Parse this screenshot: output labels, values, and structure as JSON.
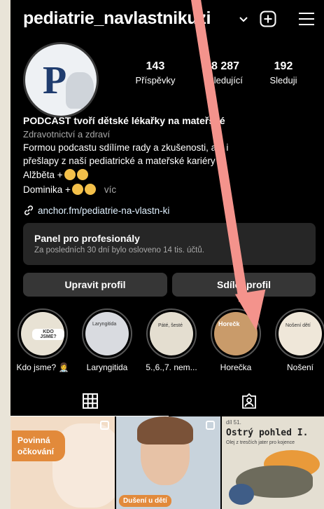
{
  "header": {
    "username": "pediatrie_navlastnikuzi"
  },
  "profile": {
    "avatar_letter": "P",
    "stats": [
      {
        "value": "143",
        "label": "Příspěvky"
      },
      {
        "value": "8 287",
        "label": "Sledující"
      },
      {
        "value": "192",
        "label": "Sleduji"
      }
    ],
    "bio": {
      "name": "PODCAST tvoří dětské lékařky na mateřské",
      "category": "Zdravotnictví a zdraví",
      "line1": "Formou podcastu sdílíme rady a zkušenosti, ale i",
      "line2": "přešlapy z naší pediatrické a mateřské kariéry",
      "line3": "Alžběta +",
      "line4": "Dominika +",
      "more": "víc"
    },
    "link": "anchor.fm/pediatrie-na-vlastn-ki"
  },
  "panel": {
    "title": "Panel pro profesionály",
    "subtitle": "Za posledních 30 dní bylo osloveno 14 tis. účtů."
  },
  "buttons": {
    "edit": "Upravit profil",
    "share": "Sdílet profil"
  },
  "highlights": [
    {
      "label": "Kdo jsme? 👩‍⚕️",
      "thumb": "KDO JSME?",
      "bg": "#e8e2d4"
    },
    {
      "label": "Laryngitida",
      "thumb": "Laryngitida",
      "bg": "#d9dbe0"
    },
    {
      "label": "5.,6.,7. nem...",
      "thumb": "Páté, šesté",
      "bg": "#e4ded0"
    },
    {
      "label": "Horečka",
      "thumb": "Horečk",
      "bg": "#c99b6a"
    },
    {
      "label": "Nošení",
      "thumb": "Nošení dětí",
      "bg": "#efe7d9"
    }
  ],
  "posts": [
    {
      "tag": "Povinná očkování",
      "bg": "#f2dcc6"
    },
    {
      "tag": "Dušení u dětí",
      "bg": "#c8d3dc"
    },
    {
      "tag": "Ostrý pohled I.",
      "sub": "Olej z tresčích jater pro kojence",
      "top": "díl 51.",
      "bg": "#e4dfd2"
    }
  ],
  "colors": {
    "annotation_arrow": "#f4938c",
    "panel_bg": "#262626",
    "button_bg": "#363636"
  }
}
